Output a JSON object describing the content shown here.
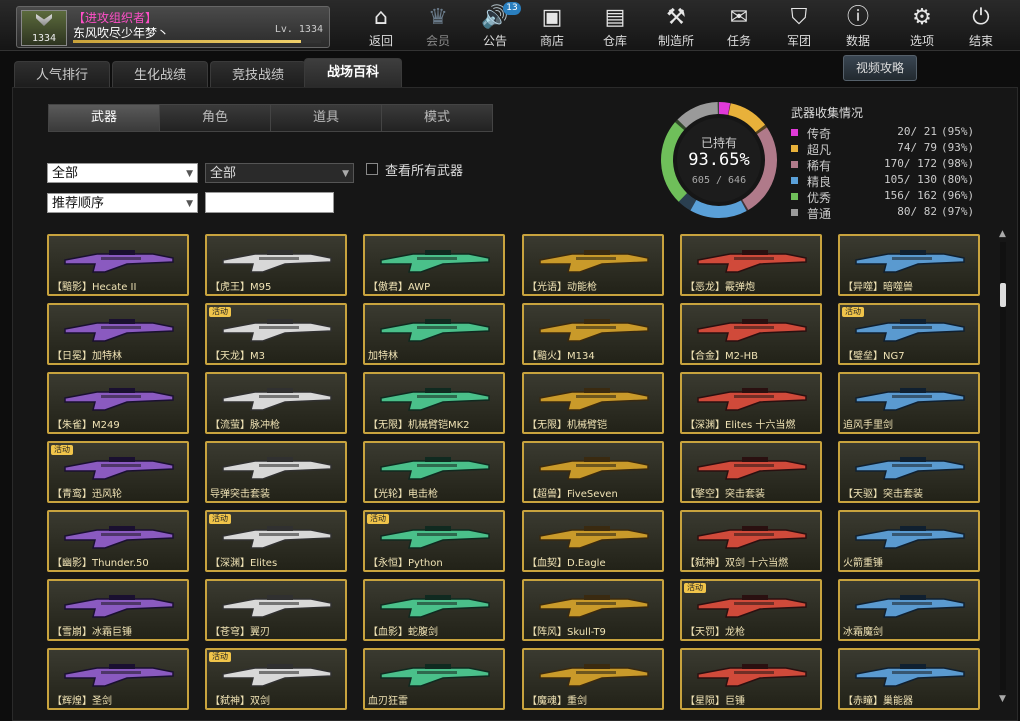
{
  "player": {
    "rank_number": "1334",
    "clan": "【进攻组织者】",
    "name": "东风吹尽少年梦丶",
    "level": "Lv. 1334",
    "xp_fraction": 0.92
  },
  "nav": [
    {
      "label": "返回",
      "icon": "home-icon",
      "glyph": "⌂"
    },
    {
      "label": "会员",
      "icon": "crown-icon",
      "glyph": "♛"
    },
    {
      "label": "公告",
      "icon": "speaker-icon",
      "glyph": "🔊",
      "badge": "13"
    },
    {
      "label": "商店",
      "icon": "shop-icon",
      "glyph": "▣"
    },
    {
      "label": "仓库",
      "icon": "briefcase-icon",
      "glyph": "▤"
    },
    {
      "label": "制造所",
      "icon": "forge-icon",
      "glyph": "⚒"
    },
    {
      "label": "任务",
      "icon": "task-icon",
      "glyph": "✉"
    },
    {
      "label": "军团",
      "icon": "shield-icon",
      "glyph": "⛉"
    },
    {
      "label": "数据",
      "icon": "data-icon",
      "glyph": "ⓘ"
    },
    {
      "label": "选项",
      "icon": "gear-icon",
      "glyph": "⚙"
    },
    {
      "label": "结束",
      "icon": "power-icon",
      "glyph": "⏻"
    }
  ],
  "top_tabs": [
    "人气排行",
    "生化战绩",
    "竞技战绩",
    "战场百科"
  ],
  "video_button": "视频攻略",
  "sub_tabs": [
    "武器",
    "角色",
    "道具",
    "模式"
  ],
  "filters": {
    "category": "全部",
    "subcategory": "全部",
    "show_all_label": "查看所有武器",
    "sort": "推荐顺序",
    "search_value": ""
  },
  "collection": {
    "owned_label": "已持有",
    "owned_pct": "93.65%",
    "owned_count": "605 / 646",
    "title": "武器收集情况",
    "rows": [
      {
        "name": "传奇",
        "count": "20/ 21",
        "pct": "(95%)",
        "color": "#e03ad8",
        "fraction": 0.95
      },
      {
        "name": "超凡",
        "count": "74/ 79",
        "pct": "(93%)",
        "color": "#e8b13a",
        "fraction": 0.93
      },
      {
        "name": "稀有",
        "count": "170/ 172",
        "pct": "(98%)",
        "color": "#b07a8a",
        "fraction": 0.98
      },
      {
        "name": "精良",
        "count": "105/ 130",
        "pct": "(80%)",
        "color": "#5aa0d8",
        "fraction": 0.8
      },
      {
        "name": "优秀",
        "count": "156/ 162",
        "pct": "(96%)",
        "color": "#6fbf5a",
        "fraction": 0.96
      },
      {
        "name": "普通",
        "count": "80/ 82",
        "pct": "(97%)",
        "color": "#9a9a9a",
        "fraction": 0.97
      }
    ]
  },
  "event_tag": "活动",
  "weapons": [
    {
      "name": "【黯影】Hecate II",
      "event": false
    },
    {
      "name": "【虎王】M95",
      "event": false
    },
    {
      "name": "【傲君】AWP",
      "event": false
    },
    {
      "name": "【光语】动能枪",
      "event": false
    },
    {
      "name": "【恶龙】霰弹炮",
      "event": false
    },
    {
      "name": "【异噬】暗噬兽",
      "event": false
    },
    {
      "name": "【日冕】加特林",
      "event": false
    },
    {
      "name": "【天龙】M3",
      "event": true
    },
    {
      "name": "加特林",
      "event": false
    },
    {
      "name": "【黯火】M134",
      "event": false
    },
    {
      "name": "【合金】M2-HB",
      "event": false
    },
    {
      "name": "【璧垒】NG7",
      "event": true
    },
    {
      "name": "【朱雀】M249",
      "event": false
    },
    {
      "name": "【流萤】脉冲枪",
      "event": false
    },
    {
      "name": "【无限】机械臂铠MK2",
      "event": false
    },
    {
      "name": "【无限】机械臂铠",
      "event": false
    },
    {
      "name": "【深渊】Elites 十六当燃",
      "event": false
    },
    {
      "name": "追风手里剑",
      "event": false
    },
    {
      "name": "【青鸾】迅风轮",
      "event": true
    },
    {
      "name": "导弹突击套装",
      "event": false
    },
    {
      "name": "【光轮】电击枪",
      "event": false
    },
    {
      "name": "【超兽】FiveSeven",
      "event": false
    },
    {
      "name": "【擎空】突击套装",
      "event": false
    },
    {
      "name": "【天驱】突击套装",
      "event": false
    },
    {
      "name": "【幽影】Thunder.50",
      "event": false
    },
    {
      "name": "【深渊】Elites",
      "event": true
    },
    {
      "name": "【永恒】Python",
      "event": true
    },
    {
      "name": "【血契】D.Eagle",
      "event": false
    },
    {
      "name": "【弑神】双剑 十六当燃",
      "event": false
    },
    {
      "name": "火箭重锤",
      "event": false
    },
    {
      "name": "【雪崩】冰霜巨锤",
      "event": false
    },
    {
      "name": "【苍穹】翼刃",
      "event": false
    },
    {
      "name": "【血影】蛇腹剑",
      "event": false
    },
    {
      "name": "【阵风】Skull-T9",
      "event": false
    },
    {
      "name": "【天罚】龙枪",
      "event": true
    },
    {
      "name": "冰霜魔剑",
      "event": false
    },
    {
      "name": "【辉煌】圣剑",
      "event": false
    },
    {
      "name": "【弑神】双剑",
      "event": true
    },
    {
      "name": "血刃狂雷",
      "event": false
    },
    {
      "name": "【魔魂】重剑",
      "event": false
    },
    {
      "name": "【星陨】巨锤",
      "event": false
    },
    {
      "name": "【赤瞳】巢能器",
      "event": false
    }
  ]
}
